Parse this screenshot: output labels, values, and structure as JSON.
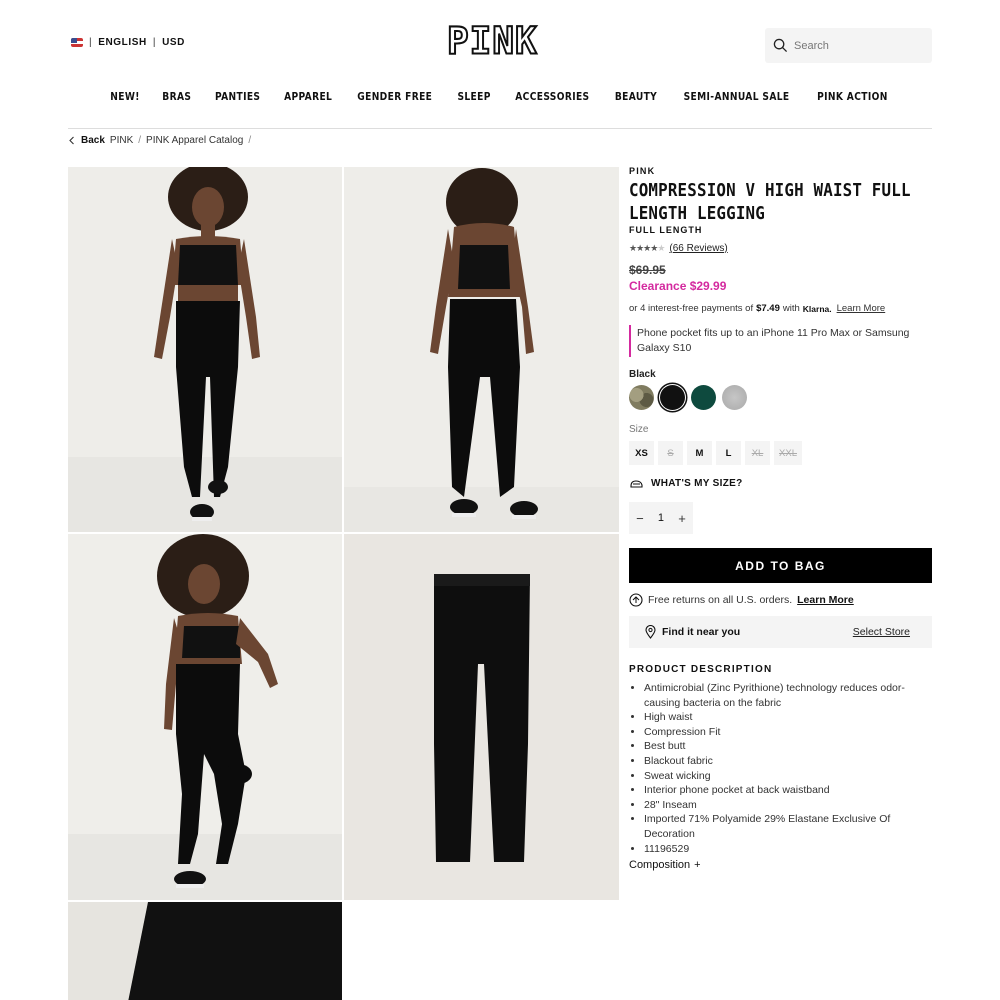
{
  "header": {
    "language": "ENGLISH",
    "currency": "USD",
    "logo_text": "PINK",
    "search_placeholder": "Search"
  },
  "nav": [
    "NEW!",
    "BRAS",
    "PANTIES",
    "APPAREL",
    "GENDER FREE",
    "SLEEP",
    "ACCESSORIES",
    "BEAUTY",
    "SEMI-ANNUAL SALE",
    "PINK ACTION"
  ],
  "breadcrumb": {
    "back": "Back",
    "items": [
      "PINK",
      "PINK Apparel Catalog"
    ]
  },
  "gallery": {
    "images": [
      "front-view-model",
      "back-view-model",
      "side-pose-model",
      "flat-lay-legging",
      "fabric-closeup"
    ]
  },
  "product": {
    "brand": "PINK",
    "title": "COMPRESSION V HIGH WAIST FULL LENGTH LEGGING",
    "subtitle": "FULL LENGTH",
    "rating": 4,
    "rating_max": 5,
    "reviews": "(66 Reviews)",
    "original_price": "$69.95",
    "sale_price": "Clearance $29.99",
    "klarna": {
      "prefix": "or 4 interest-free payments of",
      "amount": "$7.49",
      "with": "with",
      "brand": "Klarna.",
      "link": "Learn More"
    },
    "note": "Phone pocket fits up to an iPhone 11 Pro Max or Samsung Galaxy S10",
    "selected_color": "Black",
    "swatches": [
      {
        "name": "camo",
        "color": "#7d7a5e",
        "selected": false
      },
      {
        "name": "black",
        "color": "#111111",
        "selected": true
      },
      {
        "name": "green",
        "color": "#0e4a3e",
        "selected": false
      },
      {
        "name": "heather-grey",
        "color": "#b9b9b9",
        "selected": false
      }
    ],
    "size_label": "Size",
    "sizes": [
      {
        "label": "XS",
        "available": true
      },
      {
        "label": "S",
        "available": false
      },
      {
        "label": "M",
        "available": true
      },
      {
        "label": "L",
        "available": true
      },
      {
        "label": "XL",
        "available": false
      },
      {
        "label": "XXL",
        "available": false
      }
    ],
    "whats_my_size": "WHAT'S MY SIZE?",
    "quantity": "1",
    "add_to_bag": "ADD TO BAG",
    "returns_text": "Free returns on all U.S. orders.",
    "returns_link": "Learn More",
    "find_near": "Find it near you",
    "select_store": "Select Store",
    "description_title": "PRODUCT DESCRIPTION",
    "description": [
      "Antimicrobial (Zinc Pyrithione) technology reduces odor-causing bacteria on the fabric",
      "High waist",
      "Compression Fit",
      "Best butt",
      "Blackout fabric",
      "Sweat wicking",
      "Interior phone pocket at back waistband",
      "28\" Inseam",
      "Imported 71% Polyamide 29% Elastane Exclusive Of Decoration",
      "11196529"
    ],
    "composition": "Composition"
  },
  "colors": {
    "accent_pink": "#d42a9f",
    "button_black": "#000000",
    "panel_grey": "#f4f4f4"
  }
}
